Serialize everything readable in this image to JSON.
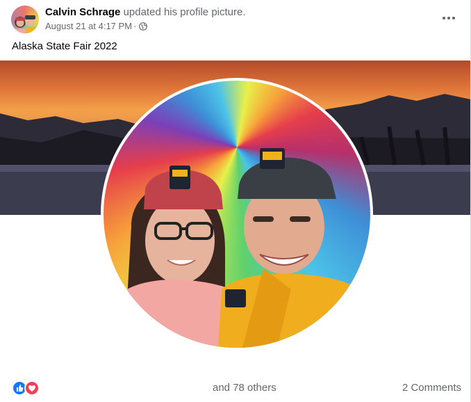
{
  "post": {
    "author": "Calvin Schrage",
    "action": "updated his profile picture.",
    "timestamp": "August 21 at 4:17 PM",
    "separator": "·",
    "privacy_icon": "globe-icon",
    "more_icon": "more-horizontal-icon",
    "caption": "Alaska State Fair 2022"
  },
  "media": {
    "cover_description_icon": "cover-photo",
    "profile_photo_icon": "profile-photo"
  },
  "footer": {
    "reaction_icons": [
      "like-icon",
      "love-icon"
    ],
    "reaction_summary": "and 78 others",
    "comments": "2 Comments"
  },
  "colors": {
    "like_blue": "#1877f2",
    "love_red": "#f33e58",
    "secondary_text": "#65676b"
  }
}
